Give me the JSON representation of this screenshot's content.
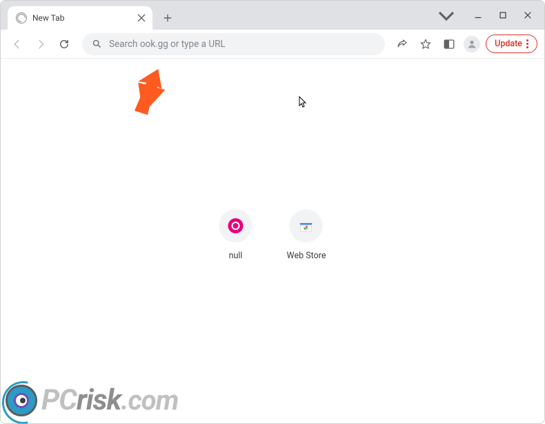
{
  "tab": {
    "title": "New Tab"
  },
  "omnibox": {
    "placeholder": "Search ook.gg or type a URL"
  },
  "toolbar": {
    "update_label": "Update"
  },
  "shortcuts": [
    {
      "label": "null"
    },
    {
      "label": "Web Store"
    }
  ],
  "watermark": {
    "text_p1": "PC",
    "text_p2": "risk",
    "text_p3": ".com"
  }
}
